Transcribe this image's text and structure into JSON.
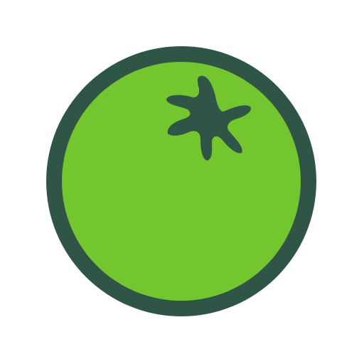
{
  "icon": {
    "name": "green-tomato-icon",
    "colors": {
      "body": "#74C62E",
      "outline": "#2F5546",
      "stem": "#2F5546",
      "background": "#FFFFFF"
    }
  }
}
